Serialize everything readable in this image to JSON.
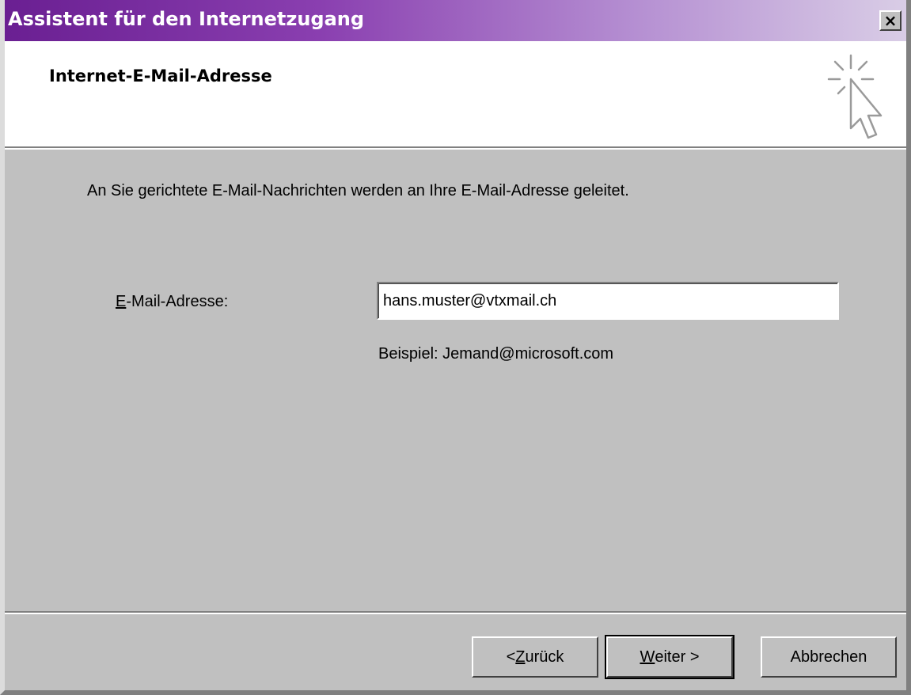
{
  "window": {
    "title": "Assistent für den Internetzugang",
    "close_label": "×"
  },
  "header": {
    "title": "Internet-E-Mail-Adresse",
    "icon": "wizard-sparkle-cursor-icon"
  },
  "body": {
    "intro": "An Sie gerichtete E-Mail-Nachrichten werden an Ihre E-Mail-Adresse geleitet.",
    "email_label_mnemonic": "E",
    "email_label_rest": "-Mail-Adresse:",
    "email_value": "hans.muster@vtxmail.ch",
    "example": "Beispiel: Jemand@microsoft.com"
  },
  "buttons": {
    "back_prefix": "< ",
    "back_mnemonic": "Z",
    "back_rest": "urück",
    "next_mnemonic": "W",
    "next_rest": "eiter >",
    "cancel": "Abbrechen"
  },
  "colors": {
    "titlebar_start": "#6a1f92",
    "titlebar_end": "#d9cde6",
    "dialog_bg": "#c0c0c0"
  }
}
